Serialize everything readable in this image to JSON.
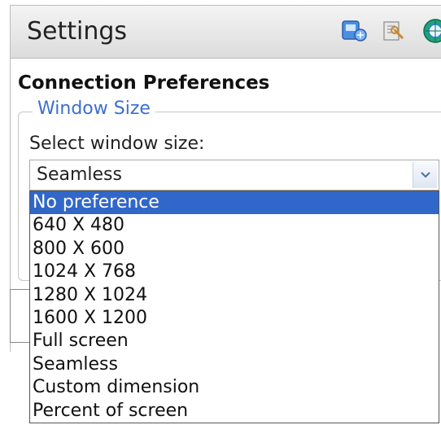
{
  "header": {
    "title": "Settings",
    "icons": [
      "network-settings-icon",
      "tools-icon",
      "help-icon"
    ]
  },
  "section": {
    "title": "Connection Preferences"
  },
  "window_size": {
    "legend": "Window Size",
    "label": "Select window size:",
    "selected_value": "Seamless",
    "highlighted_option": "No preference",
    "options": [
      "No preference",
      "640 X 480",
      "800 X 600",
      "1024 X 768",
      "1280 X 1024",
      "1600 X 1200",
      "Full screen",
      "Seamless",
      "Custom dimension",
      "Percent of screen"
    ]
  },
  "colors": {
    "highlight": "#3167c8",
    "legend_text": "#3a6fd0",
    "header_bg_top": "#f4f4f4",
    "header_bg_bottom": "#dcdcdc"
  }
}
